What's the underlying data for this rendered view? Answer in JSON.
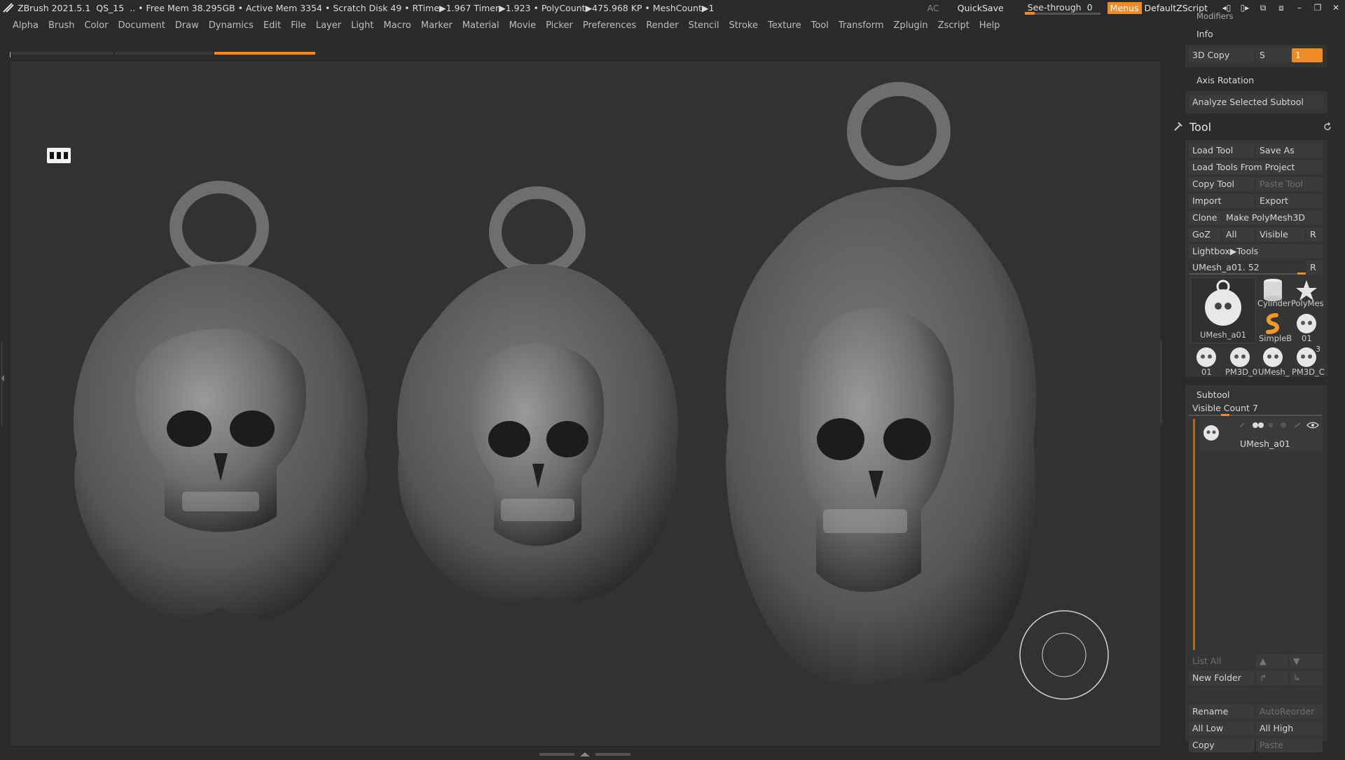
{
  "titlebar": {
    "app": "ZBrush 2021.5.1",
    "doc": "QS_15",
    "stats": ".. • Free Mem 38.295GB • Active Mem 3354 • Scratch Disk 49 •  RTime▶1.967 Timer▶1.923 • PolyCount▶475.968 KP  • MeshCount▶1",
    "ac": "AC",
    "quicksave": "QuickSave",
    "see_through_label": "See-through",
    "see_through_value": "0",
    "see_through_level": 0,
    "menus": "Menus",
    "script": "DefaultZScript"
  },
  "menubar": [
    "Alpha",
    "Brush",
    "Color",
    "Document",
    "Draw",
    "Dynamics",
    "Edit",
    "File",
    "Layer",
    "Light",
    "Macro",
    "Marker",
    "Material",
    "Movie",
    "Picker",
    "Preferences",
    "Render",
    "Stencil",
    "Stroke",
    "Texture",
    "Tool",
    "Transform",
    "Zplugin",
    "Zscript",
    "Help"
  ],
  "top_panel": {
    "modifiers": "Modifiers",
    "info": "Info",
    "copy3d": "3D Copy",
    "s_label": "S",
    "s_value": "1",
    "axis_rotation": "Axis Rotation",
    "analyze": "Analyze Selected Subtool"
  },
  "tool": {
    "title": "Tool",
    "load_tool": "Load Tool",
    "save_as": "Save As",
    "load_from_project": "Load Tools From Project",
    "copy_tool": "Copy Tool",
    "paste_tool": "Paste Tool",
    "import": "Import",
    "export": "Export",
    "clone": "Clone",
    "make_polymesh": "Make PolyMesh3D",
    "goz": "GoZ",
    "all": "All",
    "visible": "Visible",
    "r": "R",
    "lightbox": "Lightbox▶Tools",
    "current": "UMesh_a01. 52",
    "thumbs": [
      "UMesh_a01",
      "Cylinder",
      "PolyMes",
      "SimpleB",
      "01",
      "01",
      "PM3D_0",
      "UMesh_",
      "PM3D_C"
    ],
    "thumb_badge": "3"
  },
  "subtool": {
    "title": "Subtool",
    "visible_count": "Visible Count 7",
    "item": "UMesh_a01",
    "list_all": "List All",
    "new_folder": "New Folder",
    "rename": "Rename",
    "autoreorder": "AutoReorder",
    "all_low": "All Low",
    "all_high": "All High",
    "copy": "Copy",
    "paste": "Paste"
  },
  "colors": {
    "accent": "#f08a24",
    "background": "#2b2b2b",
    "canvas": "#323232"
  }
}
